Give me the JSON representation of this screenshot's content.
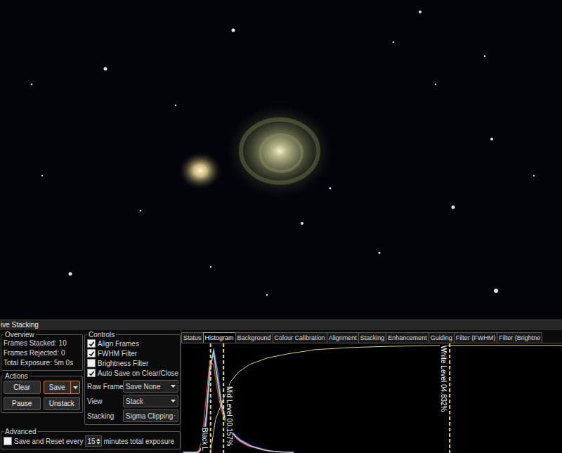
{
  "panel": {
    "title": "ive Stacking"
  },
  "overview": {
    "legend": "Overview",
    "stats": [
      {
        "label": "Frames Stacked:",
        "value": "10"
      },
      {
        "label": "Frames Rejected:",
        "value": "0"
      },
      {
        "label": "Total Exposure:",
        "value": "5m 0s"
      }
    ]
  },
  "actions": {
    "legend": "Actions",
    "buttons": [
      {
        "label": "Clear",
        "focused": false,
        "kind": "plain"
      },
      {
        "label": "Save",
        "focused": true,
        "kind": "split"
      },
      {
        "label": "Pause",
        "focused": false,
        "kind": "plain"
      },
      {
        "label": "Unstack",
        "focused": false,
        "kind": "plain"
      }
    ]
  },
  "controls": {
    "legend": "Controls",
    "checkboxes": [
      {
        "label": "Align Frames",
        "checked": true
      },
      {
        "label": "FWHM Filter",
        "checked": true
      },
      {
        "label": "Brightness Filter",
        "checked": false
      },
      {
        "label": "Auto Save on Clear/Close",
        "checked": true
      }
    ],
    "selects": [
      {
        "label": "Raw Frames",
        "value": "Save None"
      },
      {
        "label": "View",
        "value": "Stack"
      },
      {
        "label": "Stacking",
        "value": "Sigma Clipping"
      }
    ]
  },
  "advanced": {
    "legend": "Advanced",
    "checked": false,
    "label_before": "Save and Reset every",
    "value": "15",
    "label_after": "minutes total exposure"
  },
  "tabs": [
    {
      "label": "Status",
      "selected": false
    },
    {
      "label": "Histogram",
      "selected": true
    },
    {
      "label": "Background",
      "selected": false
    },
    {
      "label": "Colour Calibration",
      "selected": false
    },
    {
      "label": "Alignment",
      "selected": false
    },
    {
      "label": "Stacking",
      "selected": false
    },
    {
      "label": "Enhancement",
      "selected": false
    },
    {
      "label": "Guiding",
      "selected": false
    },
    {
      "label": "Filter (FWHM)",
      "selected": false
    },
    {
      "label": "Filter (Brightne",
      "selected": false
    }
  ],
  "histogram": {
    "series": [
      {
        "name": "red",
        "color": "#e03a3a",
        "values": [
          0,
          0,
          0,
          0,
          0.01,
          0.12,
          0.5,
          0.86,
          0.82,
          0.58,
          0.4,
          0.29,
          0.22,
          0.17,
          0.13,
          0.1,
          0.08,
          0.06,
          0.05,
          0.04,
          0.03,
          0.02,
          0.015,
          0.01,
          0.007,
          0.005,
          0.003,
          0.002,
          0.001,
          0
        ]
      },
      {
        "name": "green",
        "color": "#3fbf3f",
        "values": [
          0,
          0,
          0,
          0,
          0,
          0.06,
          0.35,
          0.8,
          0.92,
          0.66,
          0.44,
          0.31,
          0.23,
          0.18,
          0.14,
          0.11,
          0.09,
          0.07,
          0.055,
          0.045,
          0.035,
          0.025,
          0.018,
          0.012,
          0.008,
          0.005,
          0.003,
          0.002,
          0.001,
          0
        ]
      },
      {
        "name": "blue",
        "color": "#4a6cff",
        "values": [
          0,
          0,
          0,
          0,
          0,
          0.03,
          0.22,
          0.7,
          0.98,
          0.78,
          0.5,
          0.34,
          0.25,
          0.19,
          0.15,
          0.12,
          0.1,
          0.08,
          0.06,
          0.05,
          0.04,
          0.03,
          0.02,
          0.014,
          0.009,
          0.006,
          0.004,
          0.002,
          0.001,
          0
        ]
      },
      {
        "name": "luminance",
        "color": "#c8c8d8",
        "values": [
          0,
          0,
          0,
          0,
          0,
          0.05,
          0.3,
          0.78,
          0.96,
          0.7,
          0.46,
          0.32,
          0.24,
          0.18,
          0.14,
          0.11,
          0.09,
          0.07,
          0.055,
          0.045,
          0.035,
          0.025,
          0.018,
          0.012,
          0.008,
          0.005,
          0.003,
          0.002,
          0.001,
          0
        ]
      }
    ],
    "transfer_curve": [
      [
        7.7,
        0
      ],
      [
        9,
        0.3
      ],
      [
        11.1,
        0.5
      ],
      [
        13,
        0.66
      ],
      [
        15.1,
        0.75
      ],
      [
        18,
        0.82
      ],
      [
        22.5,
        0.88
      ],
      [
        28,
        0.92
      ],
      [
        35.4,
        0.96
      ],
      [
        45,
        0.98
      ],
      [
        53.9,
        0.99
      ],
      [
        70,
        1
      ],
      [
        100,
        1
      ]
    ],
    "markers": [
      {
        "label": "Black L",
        "at": 7.7,
        "kind": "black"
      },
      {
        "label": "Mid Level 00.157%",
        "at": 11.1,
        "kind": "mid"
      },
      {
        "label": "White Level 04.832%",
        "at": 70.5,
        "kind": "white"
      }
    ]
  }
}
